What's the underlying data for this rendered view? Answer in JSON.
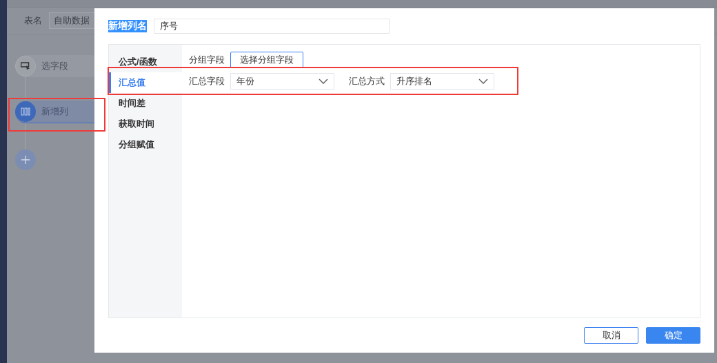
{
  "background": {
    "field_label": "表名",
    "field_value": "自助数据",
    "steps": [
      {
        "label": "选字段",
        "selected": false,
        "kind": "select"
      },
      {
        "label": "新增列",
        "selected": true,
        "kind": "column"
      }
    ]
  },
  "dialog": {
    "name_label": "新增列名",
    "name_value": "序号",
    "menu": [
      {
        "label": "公式/函数",
        "selected": false
      },
      {
        "label": "汇总值",
        "selected": true
      },
      {
        "label": "时间差",
        "selected": false
      },
      {
        "label": "获取时间",
        "selected": false
      },
      {
        "label": "分组赋值",
        "selected": false
      }
    ],
    "group_field": {
      "label": "分组字段",
      "button": "选择分组字段"
    },
    "summary_field": {
      "label": "汇总字段",
      "value": "年份"
    },
    "summary_method": {
      "label": "汇总方式",
      "value": "升序排名"
    },
    "buttons": [
      {
        "label": "取消",
        "kind": "secondary"
      },
      {
        "label": "确定",
        "kind": "primary"
      }
    ]
  }
}
